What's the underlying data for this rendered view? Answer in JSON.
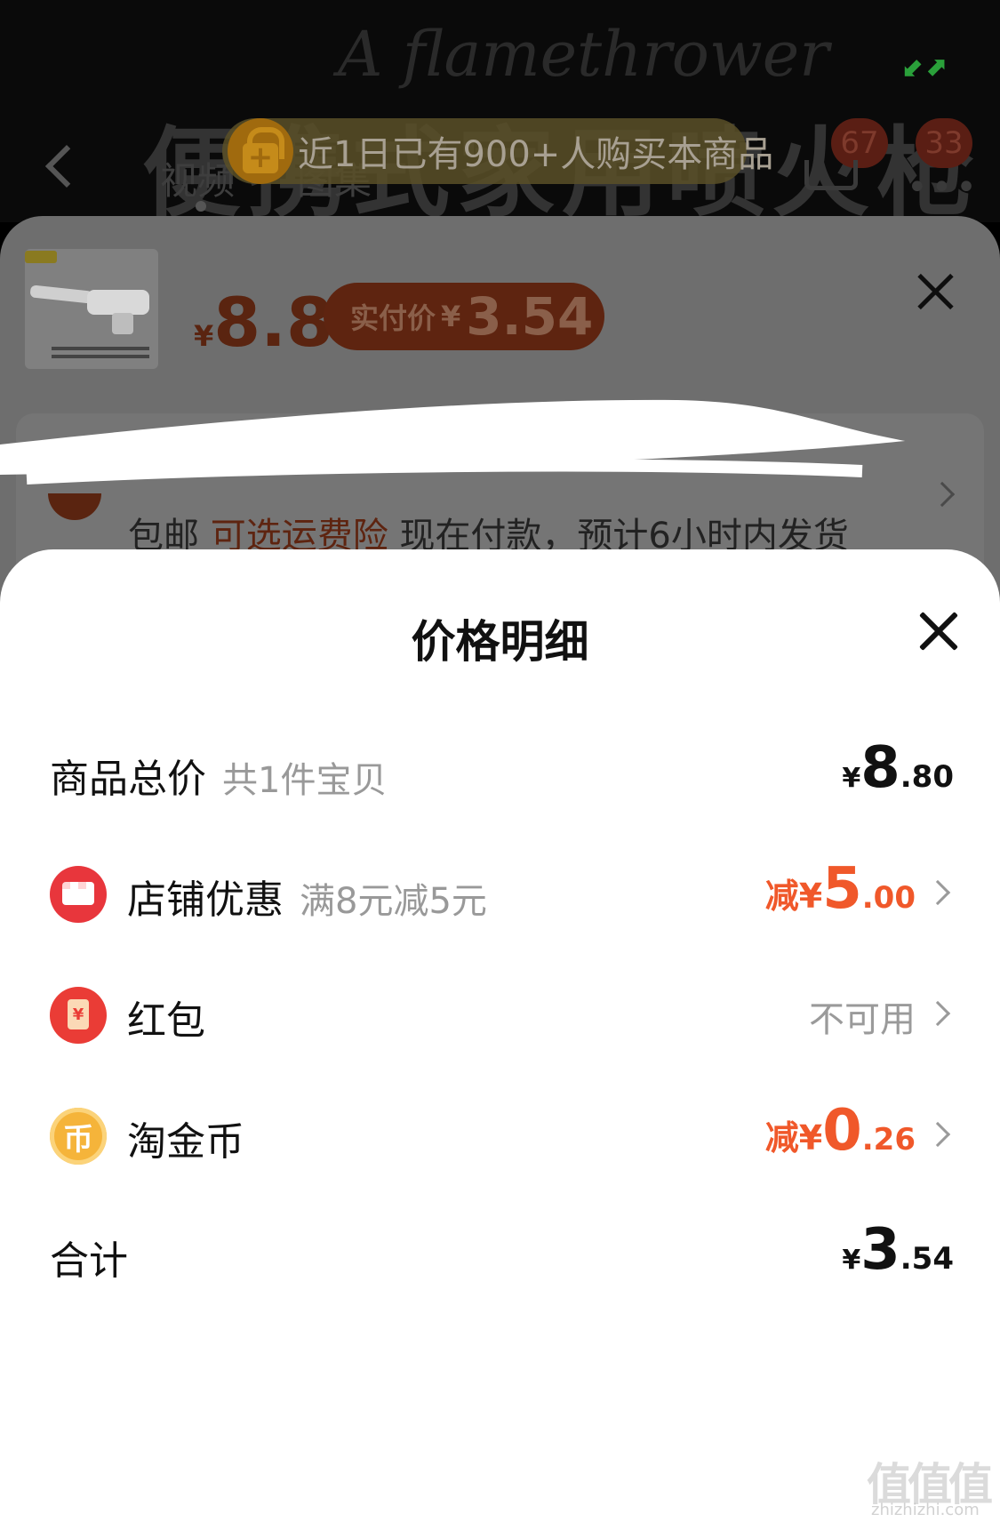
{
  "background": {
    "watermark": "A flamethrower",
    "title": "便携式家用喷火枪",
    "tabs": [
      "视频",
      "图集"
    ],
    "banner_text": "近1日已有900+人购买本商品",
    "cart_badge": "67",
    "more_badge": "33",
    "price_currency": "¥",
    "price": "8.8",
    "paid_label": "实付价",
    "paid_currency": "¥",
    "paid_amount": "3.54",
    "shipping": {
      "free": "包邮",
      "insurance": "可选运费险",
      "delivery": "现在付款，预计6小时内发货"
    }
  },
  "price_sheet": {
    "title": "价格明细",
    "rows": [
      {
        "label": "商品总价",
        "sub": "共1件宝贝",
        "currency": "¥",
        "integer": "8",
        "decimal": ".80",
        "color": "#111111"
      },
      {
        "icon": "shop-icon",
        "label": "店铺优惠",
        "sub": "满8元减5元",
        "prefix": "减¥",
        "integer": "5",
        "decimal": ".00",
        "color": "#f0582a"
      },
      {
        "icon": "red-packet-icon",
        "label": "红包",
        "status": "不可用"
      },
      {
        "icon": "coin-icon",
        "icon_glyph": "币",
        "label": "淘金币",
        "prefix": "减¥",
        "integer": "0",
        "decimal": ".26",
        "color": "#f0582a"
      },
      {
        "label": "合计",
        "currency": "¥",
        "integer": "3",
        "decimal": ".54",
        "color": "#111111"
      }
    ]
  },
  "red_packet_glyph": "¥",
  "site_watermark": "值值值",
  "site_watermark_url": "zhizhizhi.com"
}
